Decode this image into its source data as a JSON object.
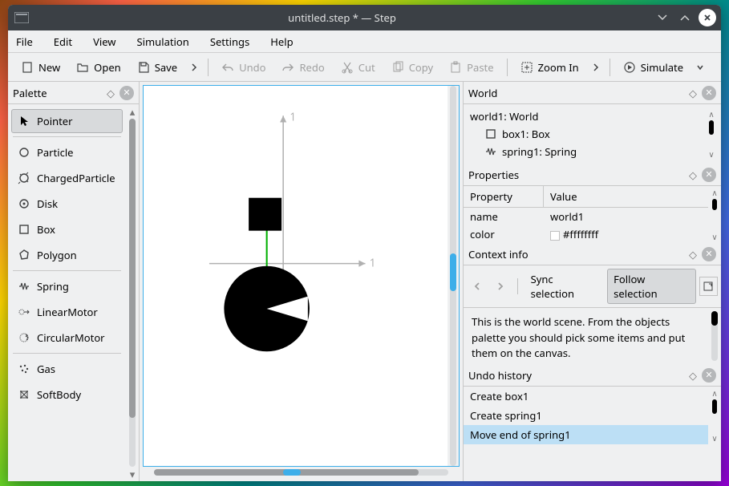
{
  "window": {
    "title": "untitled.step * — Step"
  },
  "menu": {
    "file": "File",
    "edit": "Edit",
    "view": "View",
    "simulation": "Simulation",
    "settings": "Settings",
    "help": "Help"
  },
  "toolbar": {
    "new": "New",
    "open": "Open",
    "save": "Save",
    "undo": "Undo",
    "redo": "Redo",
    "cut": "Cut",
    "copy": "Copy",
    "paste": "Paste",
    "zoom_in": "Zoom In",
    "simulate": "Simulate"
  },
  "palette": {
    "title": "Palette",
    "items": [
      {
        "label": "Pointer"
      },
      {
        "label": "Particle"
      },
      {
        "label": "ChargedParticle"
      },
      {
        "label": "Disk"
      },
      {
        "label": "Box"
      },
      {
        "label": "Polygon"
      },
      {
        "label": "Spring"
      },
      {
        "label": "LinearMotor"
      },
      {
        "label": "CircularMotor"
      },
      {
        "label": "Gas"
      },
      {
        "label": "SoftBody"
      }
    ]
  },
  "canvas": {
    "x_axis_label": "1",
    "y_axis_label": "1"
  },
  "world": {
    "title": "World",
    "root": "world1: World",
    "children": [
      {
        "label": "box1: Box",
        "icon": "box"
      },
      {
        "label": "spring1: Spring",
        "icon": "spring"
      }
    ]
  },
  "properties": {
    "title": "Properties",
    "head_property": "Property",
    "head_value": "Value",
    "rows": [
      {
        "prop": "name",
        "val": "world1"
      },
      {
        "prop": "color",
        "val": "#ffffffff"
      }
    ]
  },
  "context": {
    "title": "Context info",
    "sync": "Sync selection",
    "follow": "Follow selection",
    "text": "This is the world scene. From the objects palette you should pick some items and put them on the canvas."
  },
  "undo": {
    "title": "Undo history",
    "items": [
      {
        "label": "Create box1"
      },
      {
        "label": "Create spring1"
      },
      {
        "label": "Move end of spring1"
      }
    ]
  }
}
